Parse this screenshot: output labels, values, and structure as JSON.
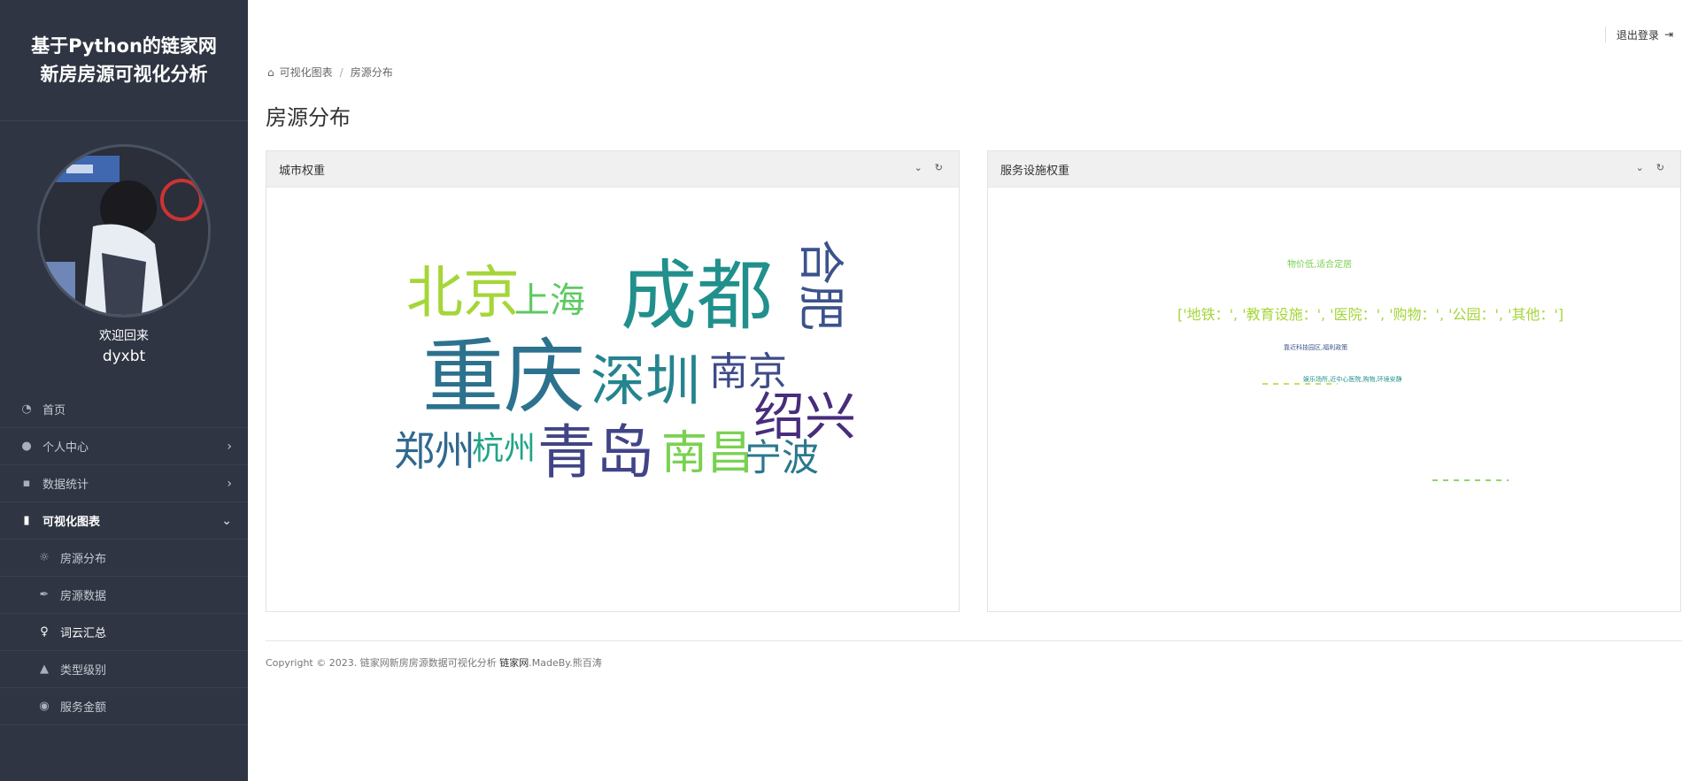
{
  "brand": {
    "line1": "基于Python的链家网",
    "line2": "新房房源可视化分析"
  },
  "profile": {
    "welcome": "欢迎回来",
    "username": "dyxbt"
  },
  "menu": [
    {
      "label": "首页",
      "icon": "dashboard-icon"
    },
    {
      "label": "个人中心",
      "icon": "user-icon"
    },
    {
      "label": "数据统计",
      "icon": "grid-icon"
    },
    {
      "label": "可视化图表",
      "icon": "bar-chart-icon"
    },
    {
      "label": "房源分布",
      "icon": "sun-icon"
    },
    {
      "label": "房源数据",
      "icon": "feather-icon"
    },
    {
      "label": "词云汇总",
      "icon": "lightbulb-icon"
    },
    {
      "label": "类型级别",
      "icon": "graduation-cap-icon"
    },
    {
      "label": "服务金额",
      "icon": "globe-icon"
    }
  ],
  "header": {
    "logout": "退出登录"
  },
  "breadcrumb": {
    "item1": "可视化图表",
    "item2": "房源分布"
  },
  "page_title": "房源分布",
  "panels": {
    "left": {
      "title": "城市权重",
      "words": [
        "北京",
        "上海",
        "成都",
        "合肥",
        "重庆",
        "深圳",
        "南京",
        "绍兴",
        "郑州",
        "杭州",
        "青岛",
        "南昌",
        "宁波"
      ]
    },
    "right": {
      "title": "服务设施权重",
      "words": [
        "物价低,适合定居",
        "['地铁：', '教育设施：', '医院：', '购物：', '公园：', '其他：']",
        "靠近科技园区,福利政策",
        "娱乐场所,近中心医院,购物,环境安静"
      ]
    }
  },
  "footer": {
    "text": "Copyright © 2023. 链家网新房房源数据可视化分析",
    "link": "链家网",
    "suffix": ".MadeBy.熊百涛"
  },
  "colors": {
    "sidebar": "#2f3542",
    "word_green": "#a5d639",
    "word_teal": "#21908c",
    "word_blue": "#3b528b",
    "word_purple": "#472d7b",
    "word_lime": "#7ad151"
  }
}
